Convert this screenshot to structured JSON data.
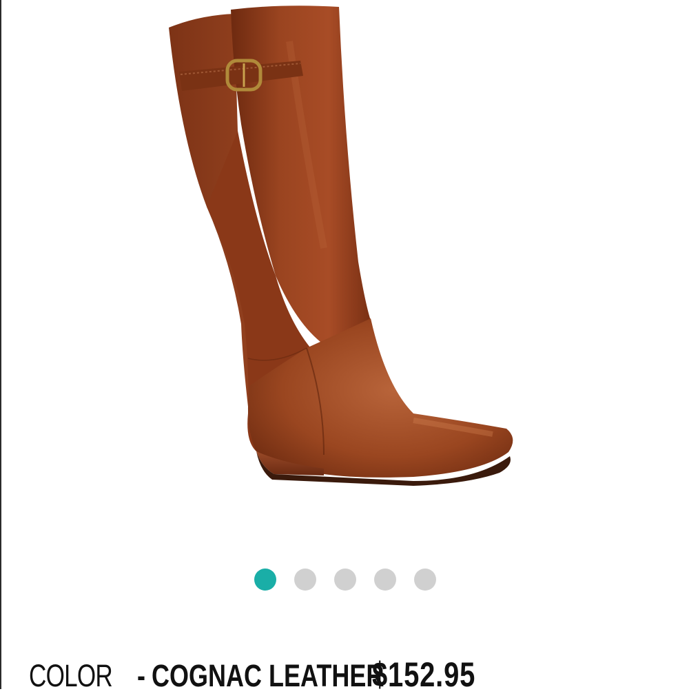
{
  "product": {
    "color_label": "COLOR",
    "separator": "-",
    "color_value": "COGNAC LEATHER",
    "price": "$152.95"
  },
  "gallery": {
    "image_count": 5,
    "active_index": 0,
    "accent_color": "#1aaea7",
    "inactive_color": "#d0d0d0"
  },
  "colors": {
    "leather": "#8a3a1c",
    "leather_highlight": "#b55a32"
  }
}
